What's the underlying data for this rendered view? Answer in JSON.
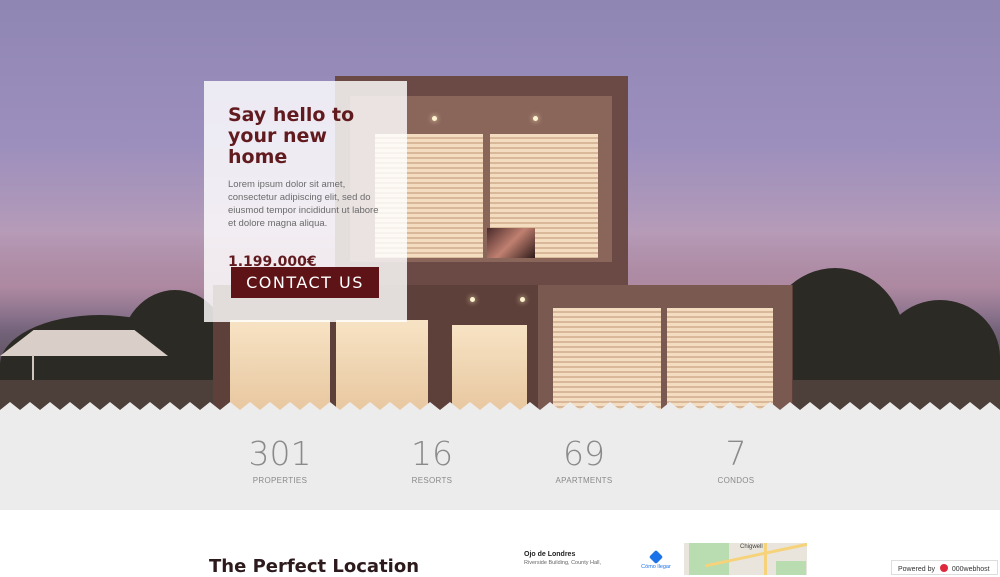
{
  "hero": {
    "title": "Say hello to your new home",
    "description": "Lorem ipsum dolor sit amet, consectetur adipiscing elit, sed do eiusmod tempor incididunt ut labore et dolore magna aliqua.",
    "price": "1.199.000€",
    "contact_label": "CONTACT US"
  },
  "stats": [
    {
      "number": "301",
      "label": "PROPERTIES"
    },
    {
      "number": "16",
      "label": "RESORTS"
    },
    {
      "number": "69",
      "label": "APARTMENTS"
    },
    {
      "number": "7",
      "label": "CONDOS"
    }
  ],
  "location": {
    "title": "The Perfect Location"
  },
  "map": {
    "place_name": "Ojo de Londres",
    "address": "Riverside Building, County Hall,",
    "directions_label": "Cómo llegar",
    "town_label": "Chigwell"
  },
  "badge": {
    "prefix": "Powered by",
    "brand": "000webhost"
  },
  "colors": {
    "accent": "#611b1e",
    "button": "#5e1416",
    "stats_bg": "#ececec"
  }
}
